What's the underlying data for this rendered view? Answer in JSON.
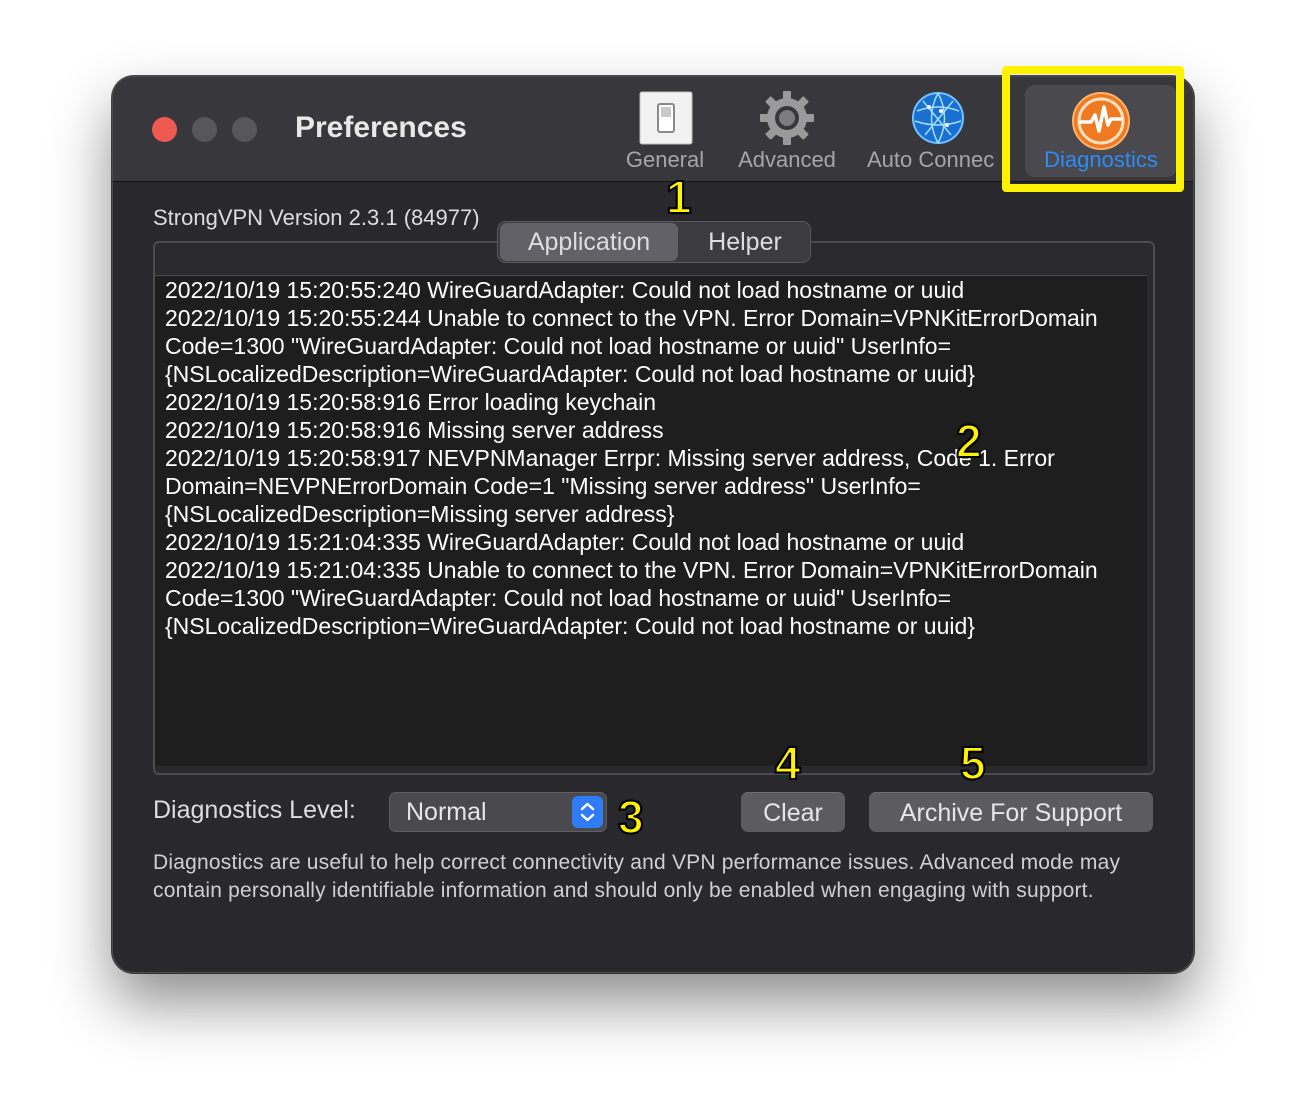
{
  "window": {
    "title": "Preferences"
  },
  "toolbar": {
    "items": [
      {
        "label": "General",
        "icon": "switch-icon"
      },
      {
        "label": "Advanced",
        "icon": "gear-icon"
      },
      {
        "label": "Auto Connec",
        "icon": "globe-icon"
      },
      {
        "label": "Diagnostics",
        "icon": "activity-icon",
        "selected": true
      }
    ]
  },
  "version": "StrongVPN Version 2.3.1 (84977)",
  "tabs": {
    "application": "Application",
    "helper": "Helper",
    "selected": "Application"
  },
  "log": {
    "lines": [
      "2022/10/19 15:20:55:240  WireGuardAdapter: Could not load hostname or uuid",
      "2022/10/19 15:20:55:244  Unable to connect to the VPN. Error Domain=VPNKitErrorDomain Code=1300 \"WireGuardAdapter: Could not load hostname or uuid\" UserInfo={NSLocalizedDescription=WireGuardAdapter: Could not load hostname or uuid}",
      "2022/10/19 15:20:58:916  Error loading keychain",
      "2022/10/19 15:20:58:916  Missing server address",
      "2022/10/19 15:20:58:917  NEVPNManager Errpr: Missing server address, Code 1. Error Domain=NEVPNErrorDomain Code=1 \"Missing server address\" UserInfo={NSLocalizedDescription=Missing server address}",
      "2022/10/19 15:21:04:335  WireGuardAdapter: Could not load hostname or uuid",
      "2022/10/19 15:21:04:335  Unable to connect to the VPN. Error Domain=VPNKitErrorDomain Code=1300 \"WireGuardAdapter: Could not load hostname or uuid\" UserInfo={NSLocalizedDescription=WireGuardAdapter: Could not load hostname or uuid}"
    ]
  },
  "diagnostics_level": {
    "label": "Diagnostics Level:",
    "value": "Normal"
  },
  "buttons": {
    "clear": "Clear",
    "archive": "Archive For Support"
  },
  "help_text": "Diagnostics are useful to help correct connectivity and VPN performance issues. Advanced mode may contain personally identifiable information and should only be enabled when engaging with support.",
  "annotations": {
    "markers": [
      "1",
      "2",
      "3",
      "4",
      "5"
    ],
    "highlight_color": "#fff200"
  },
  "colors": {
    "accent": "#2d8cf5",
    "close": "#ee5a52",
    "window_bg": "#29282d"
  }
}
